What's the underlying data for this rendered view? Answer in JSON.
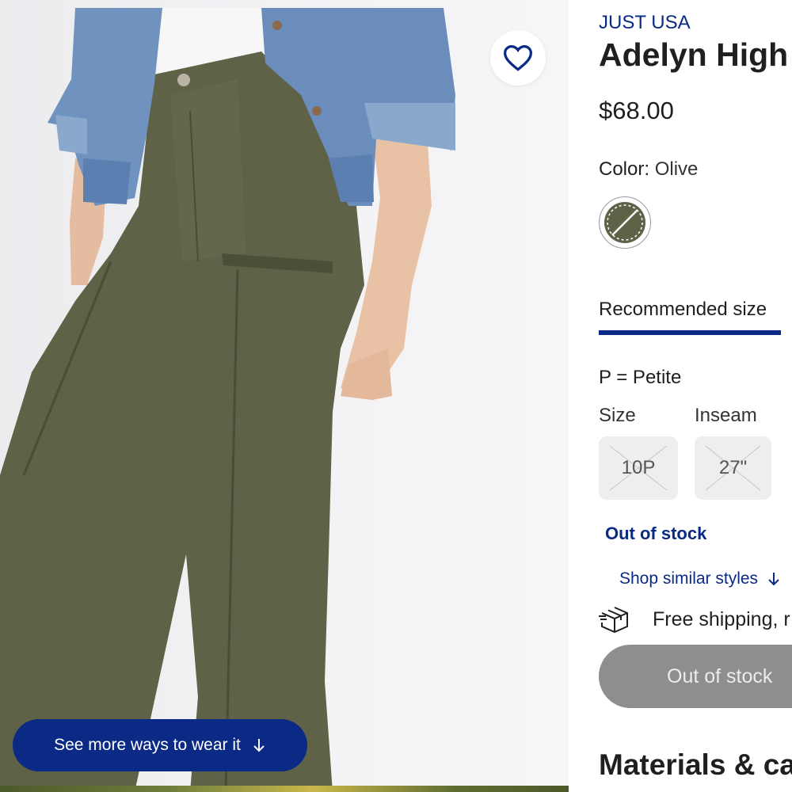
{
  "product": {
    "brand": "JUST USA",
    "title": "Adelyn High",
    "price": "$68.00"
  },
  "color": {
    "label": "Color:",
    "value": "Olive",
    "swatch_name": "Olive"
  },
  "size_section": {
    "tab_label": "Recommended size",
    "petite_key": "P",
    "petite_note": " = Petite",
    "size_label": "Size",
    "inseam_label": "Inseam",
    "size_value": "10P",
    "inseam_value": "27\"",
    "availability": "Out of stock"
  },
  "links": {
    "shop_similar": "Shop similar styles"
  },
  "shipping": {
    "text": "Free shipping, r"
  },
  "cta": {
    "primary_label": "Out of stock",
    "wear_it_label": "See more ways to wear it"
  },
  "sections": {
    "materials_heading": "Materials & car"
  },
  "colors": {
    "accent": "#0a2a85",
    "disabled_button": "#8e8e90",
    "option_bg": "#eeeef0",
    "olive": "#5f6247"
  },
  "icons": [
    "heart-icon",
    "arrow-down-icon",
    "box-shipping-icon",
    "unavailable-swatch-icon"
  ]
}
